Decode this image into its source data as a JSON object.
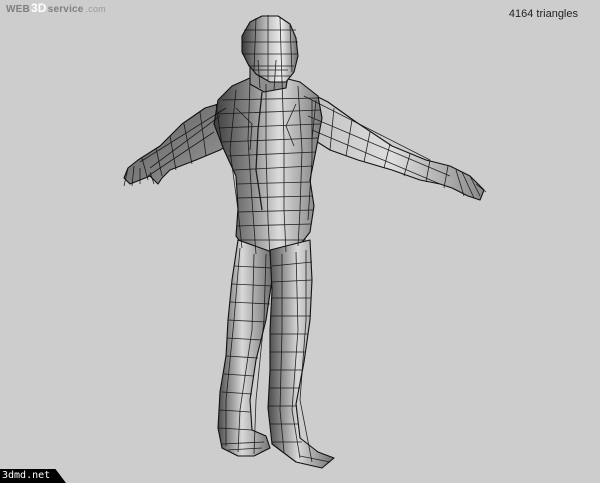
{
  "brand": {
    "prefix": "WEB",
    "highlight": "3D",
    "suffix": "service",
    "domain": ".com"
  },
  "stats": {
    "triangles_text": "4164 triangles"
  },
  "watermark": {
    "text": "3dmd.net"
  },
  "colors": {
    "background": "#cdcdcd",
    "mesh_fill_light": "#e6e6e6",
    "mesh_fill_mid": "#9a9a9a",
    "mesh_fill_dark": "#4a4a4a",
    "wire": "#111111"
  }
}
